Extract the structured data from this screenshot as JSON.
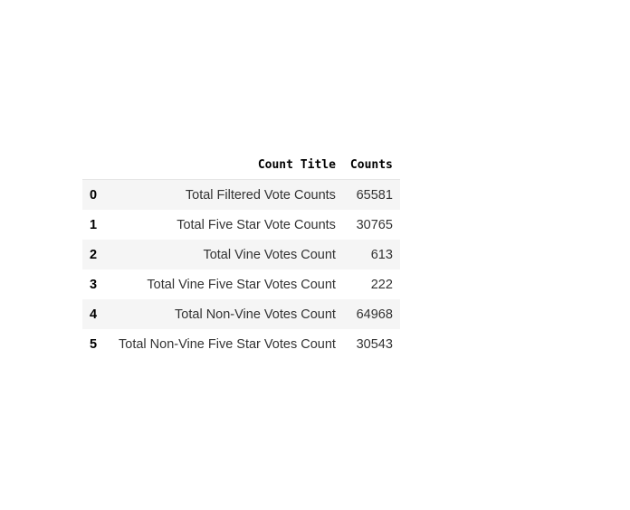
{
  "table": {
    "columns": [
      "",
      "Count Title",
      "Counts"
    ],
    "rows": [
      {
        "index": "0",
        "title": "Total Filtered Vote Counts",
        "count": "65581"
      },
      {
        "index": "1",
        "title": "Total Five Star Vote Counts",
        "count": "30765"
      },
      {
        "index": "2",
        "title": "Total Vine Votes Count",
        "count": "613"
      },
      {
        "index": "3",
        "title": "Total Vine Five Star Votes Count",
        "count": "222"
      },
      {
        "index": "4",
        "title": "Total Non-Vine Votes Count",
        "count": "64968"
      },
      {
        "index": "5",
        "title": "Total Non-Vine Five Star Votes Count",
        "count": "30543"
      }
    ]
  }
}
